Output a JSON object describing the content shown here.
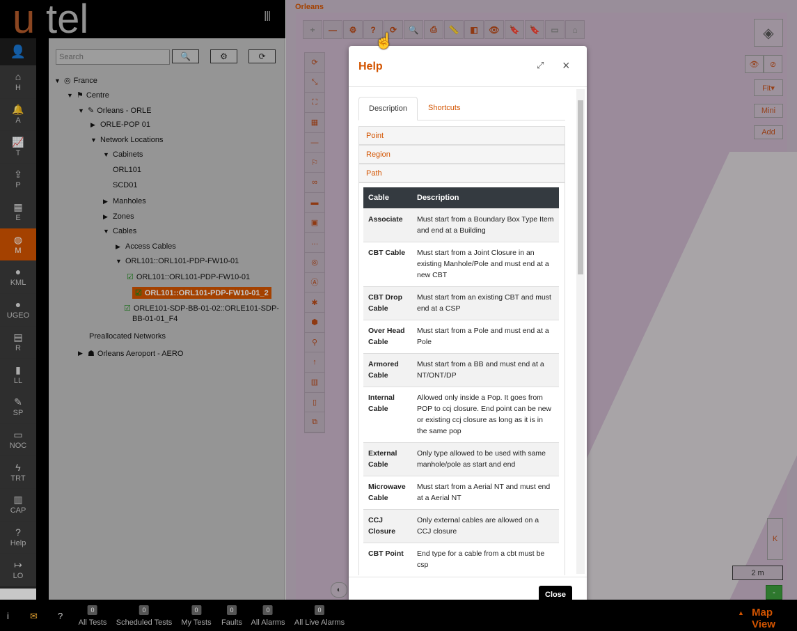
{
  "brand": {
    "u": "u",
    "tel": "tel"
  },
  "nav": [
    {
      "icon": "⌂",
      "label": "H"
    },
    {
      "icon": "🔔",
      "label": "A"
    },
    {
      "icon": "📈",
      "label": "T"
    },
    {
      "icon": "⇪",
      "label": "P"
    },
    {
      "icon": "▦",
      "label": "E"
    },
    {
      "icon": "◍",
      "label": "M"
    },
    {
      "icon": "●",
      "label": "KML"
    },
    {
      "icon": "●",
      "label": "UGEO"
    },
    {
      "icon": "▤",
      "label": "R"
    },
    {
      "icon": "▮",
      "label": "LL"
    },
    {
      "icon": "✎",
      "label": "SP"
    },
    {
      "icon": "▭",
      "label": "NOC"
    },
    {
      "icon": "ϟ",
      "label": "TRT"
    },
    {
      "icon": "▥",
      "label": "CAP"
    },
    {
      "icon": "?",
      "label": "Help"
    },
    {
      "icon": "↦",
      "label": "LO"
    }
  ],
  "tree": {
    "search_placeholder": "Search",
    "nodes": [
      {
        "text": "France",
        "arrow": "▼",
        "icon": "◎"
      },
      {
        "text": "Centre",
        "arrow": "▼",
        "icon": "⚑"
      },
      {
        "text": "Orleans - ORLE",
        "arrow": "▼",
        "icon": "✎"
      },
      {
        "text": "ORLE-POP 01",
        "arrow": "▶",
        "icon": ""
      },
      {
        "text": "Network Locations",
        "arrow": "▼",
        "icon": ""
      },
      {
        "text": "Cabinets",
        "arrow": "▼",
        "icon": ""
      },
      {
        "text": "ORL101",
        "arrow": "",
        "icon": ""
      },
      {
        "text": "SCD01",
        "arrow": "",
        "icon": ""
      },
      {
        "text": "Manholes",
        "arrow": "▶",
        "icon": ""
      },
      {
        "text": "Zones",
        "arrow": "▶",
        "icon": ""
      },
      {
        "text": "Cables",
        "arrow": "▼",
        "icon": ""
      },
      {
        "text": "Access Cables",
        "arrow": "▶",
        "icon": ""
      },
      {
        "text": "ORL101::ORL101-PDP-FW10-01",
        "arrow": "▼",
        "icon": ""
      },
      {
        "text": "ORL101::ORL101-PDP-FW10-01",
        "arrow": "",
        "icon": "☑"
      },
      {
        "text": "ORL101::ORL101-PDP-FW10-01_2",
        "arrow": "",
        "icon": "☑"
      },
      {
        "text": "ORLE101-SDP-BB-01-02::ORLE101-SDP-",
        "arrow": "",
        "icon": "☑"
      },
      {
        "text": "BB-01-01_F4",
        "arrow": "",
        "icon": ""
      },
      {
        "text": "Preallocated Networks",
        "arrow": "",
        "icon": ""
      },
      {
        "text": "Orleans Aeroport - AERO",
        "arrow": "▶",
        "icon": "☗"
      }
    ]
  },
  "map": {
    "title": "Orleans",
    "toolbar": [
      "+",
      "—",
      "⚙",
      "?",
      "⟳",
      "🔍",
      "⎙",
      "📏",
      "◧",
      "👁",
      "🔖",
      "🔖",
      "▭",
      "⌂"
    ],
    "vtools": [
      "⟳",
      "⤡",
      "⛶",
      "▦",
      "—",
      "⚐",
      "∞",
      "▬",
      "▣",
      "…",
      "◎",
      "Ⓐ",
      "✱",
      "⬢",
      "⚲",
      "↑",
      "▥",
      "▯",
      "⧉"
    ],
    "fit": "Fit▾",
    "mini": "Mini",
    "add": "Add",
    "k": "K",
    "scale": "2 m",
    "minus": "-"
  },
  "help": {
    "title": "Help",
    "tab_description": "Description",
    "tab_shortcuts": "Shortcuts",
    "sections": [
      "Point",
      "Region",
      "Path"
    ],
    "col_cable": "Cable",
    "col_description": "Description",
    "rows": [
      {
        "cable": "Associate",
        "desc": "Must start from a Boundary Box Type Item and end at a Building"
      },
      {
        "cable": "CBT Cable",
        "desc": "Must start from a Joint Closure in an existing Manhole/Pole and must end at a new CBT"
      },
      {
        "cable": "CBT Drop Cable",
        "desc": "Must start from an existing CBT and must end at a CSP"
      },
      {
        "cable": "Over Head Cable",
        "desc": "Must start from a Pole and must end at a Pole"
      },
      {
        "cable": "Armored Cable",
        "desc": "Must start from a BB and must end at a NT/ONT/DP"
      },
      {
        "cable": "Internal Cable",
        "desc": "Allowed only inside a Pop. It goes from POP to ccj closure. End point can be new or existing ccj closure as long as it is in the same pop"
      },
      {
        "cable": "External Cable",
        "desc": "Only type allowed to be used with same manhole/pole as start and end"
      },
      {
        "cable": "Microwave Cable",
        "desc": "Must start from a Aerial NT and must end at a Aerial NT"
      },
      {
        "cable": "CCJ Closure",
        "desc": "Only external cables are allowed on a CCJ closure"
      },
      {
        "cable": "CBT Point",
        "desc": "End type for a cable from a cbt must be csp"
      }
    ],
    "close": "Close"
  },
  "bottom": {
    "stats": [
      {
        "count": "0",
        "label": "All Tests"
      },
      {
        "count": "0",
        "label": "Scheduled Tests"
      },
      {
        "count": "0",
        "label": "My Tests"
      },
      {
        "count": "0",
        "label": "Faults"
      },
      {
        "count": "0",
        "label": "All Alarms"
      },
      {
        "count": "0",
        "label": "All Live Alarms"
      }
    ],
    "map_view": "Map View"
  }
}
